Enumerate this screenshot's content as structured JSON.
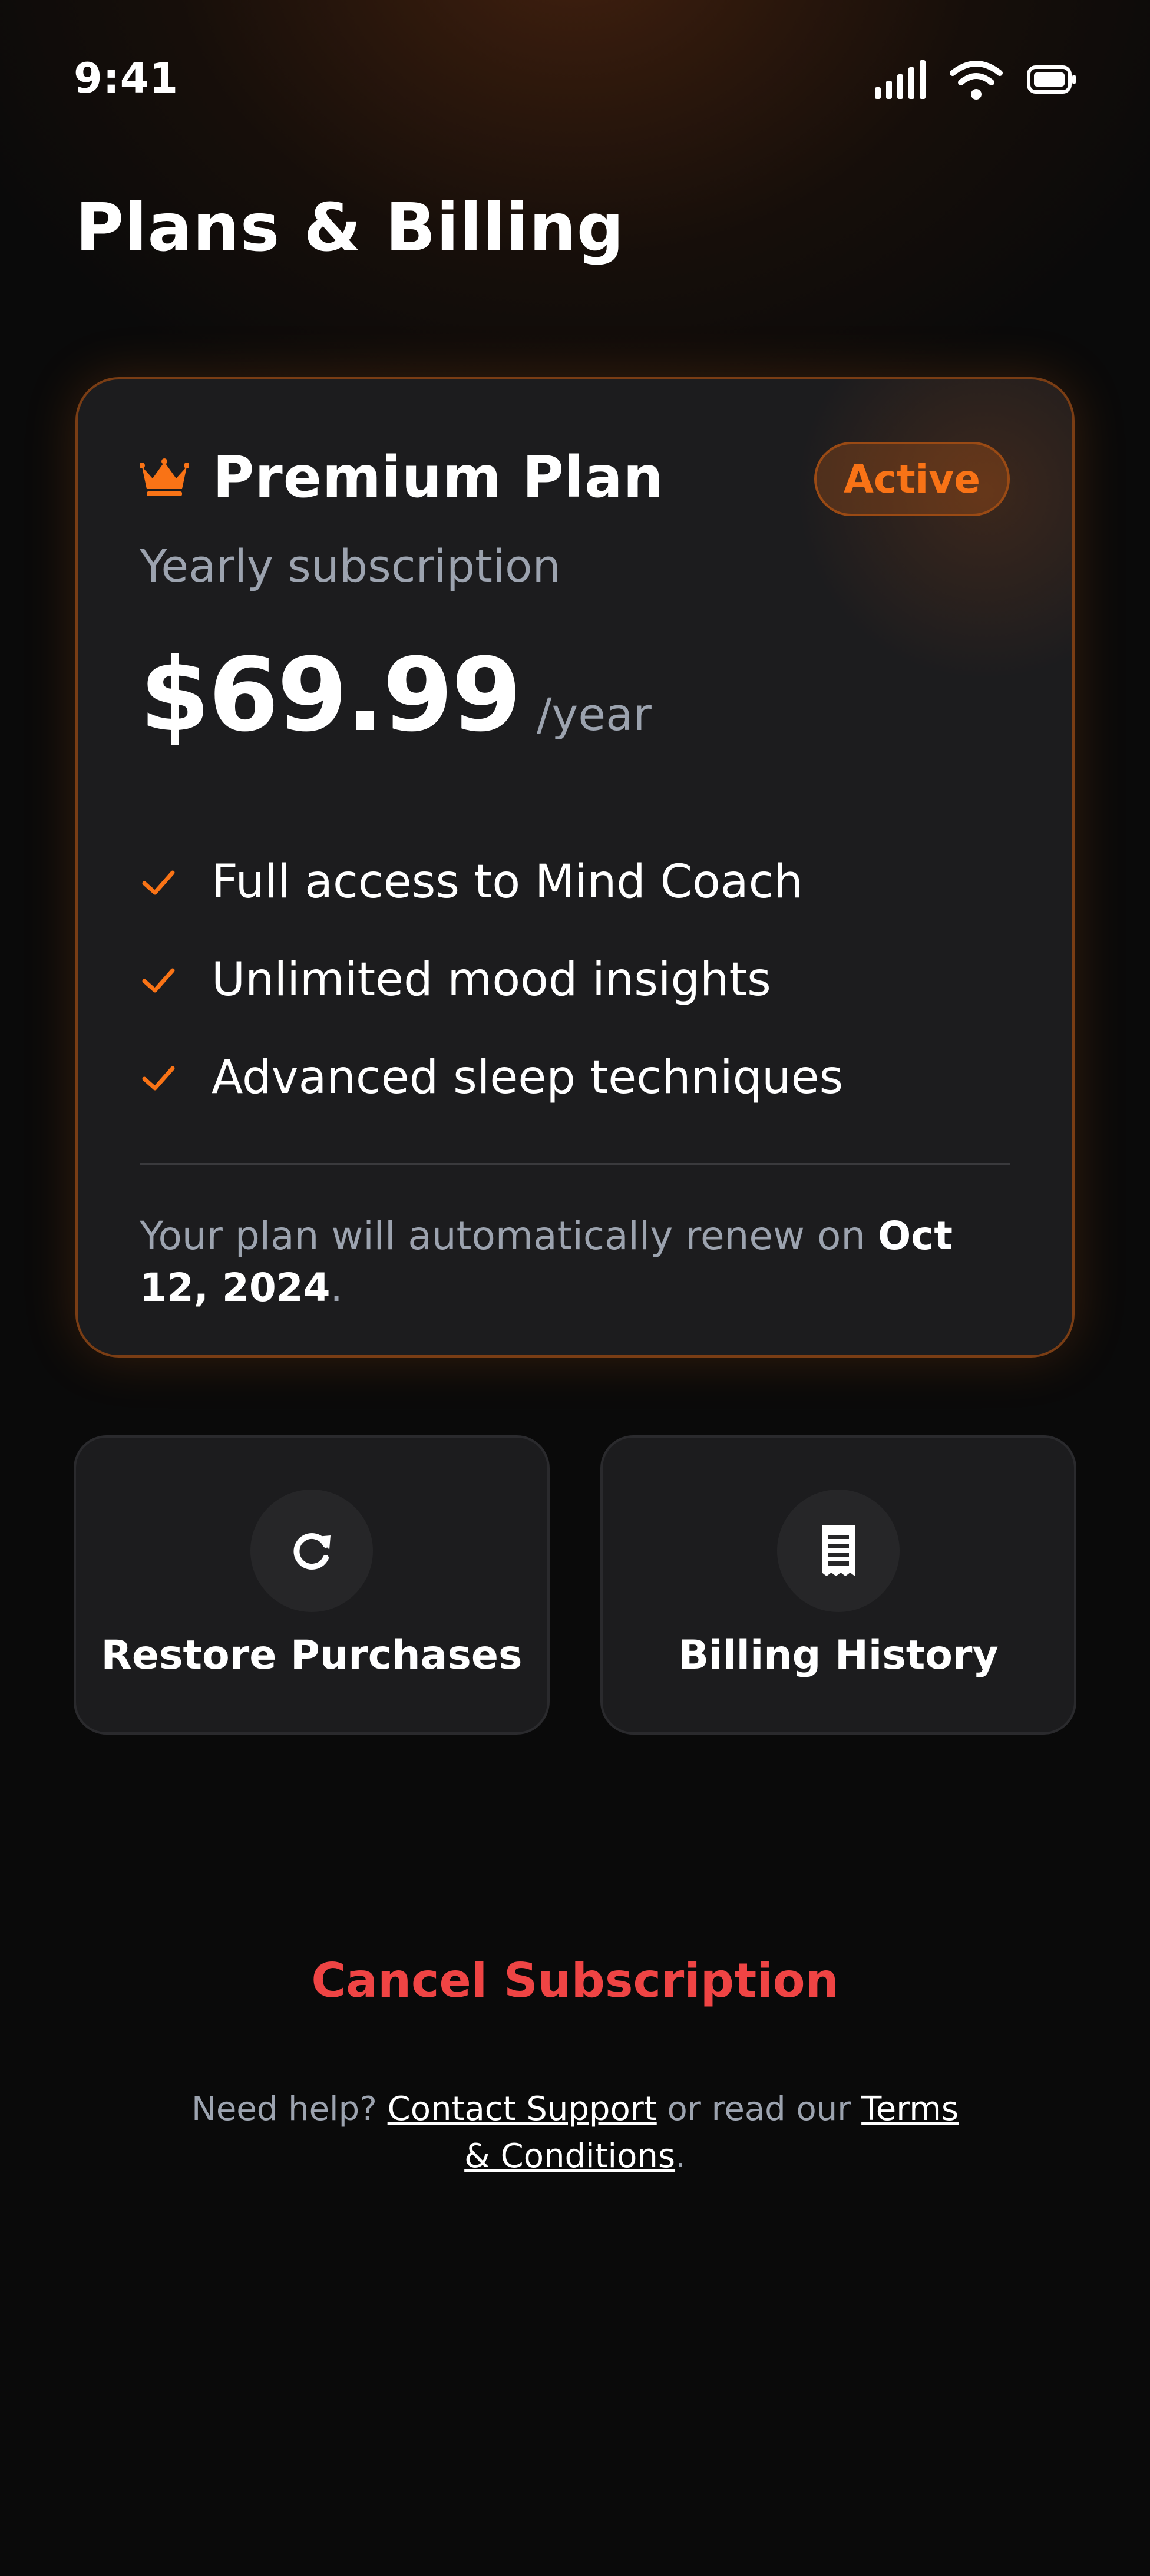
{
  "status_bar": {
    "time": "9:41"
  },
  "header": {
    "title": "Plans & Billing"
  },
  "plan": {
    "name": "Premium Plan",
    "badge": "Active",
    "subtitle": "Yearly subscription",
    "price": "$69.99",
    "period": "/year",
    "features": [
      "Full access to Mind Coach",
      "Unlimited mood insights",
      "Advanced sleep techniques"
    ],
    "renew_prefix": "Your plan will automatically renew on ",
    "renew_date": "Oct 12, 2024",
    "renew_suffix": "."
  },
  "actions": {
    "restore_label": "Restore Purchases",
    "restore_icon": "refresh-icon",
    "billing_label": "Billing History",
    "billing_icon": "receipt-icon"
  },
  "cancel_label": "Cancel Subscription",
  "help": {
    "prefix": "Need help? ",
    "contact_link": "Contact Support",
    "middle": " or read our ",
    "terms_link": "Terms & Conditions",
    "suffix": "."
  },
  "colors": {
    "accent": "#f97316",
    "danger": "#ef4444",
    "background": "#0a0a0a",
    "card": "#1c1c1e"
  }
}
